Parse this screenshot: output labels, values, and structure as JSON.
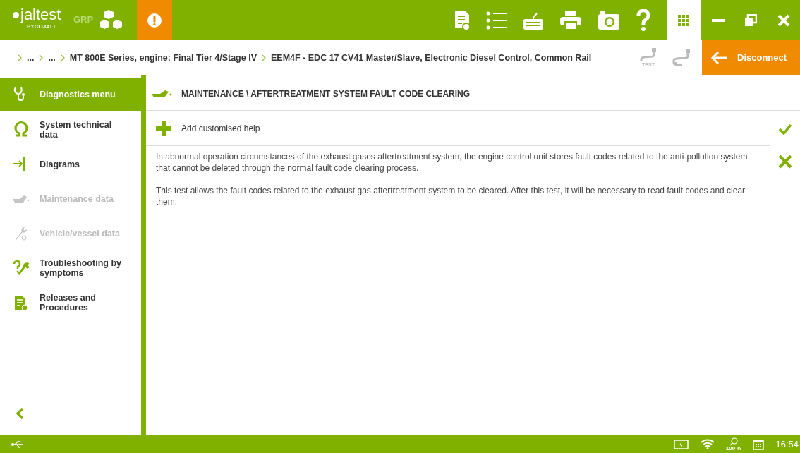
{
  "header": {
    "logo": "jaltest",
    "byline": "BY**COJALI**",
    "product": "GRP",
    "alert_active": true
  },
  "breadcrumb": {
    "items": [
      "...",
      "...",
      "MT 800E Series, engine: Final Tier 4/Stage IV",
      "EEM4F - EDC 17 CV41 Master/Slave, Electronic Diesel Control, Common Rail"
    ],
    "test_label": "TEST",
    "disconnect": "Disconnect"
  },
  "sidebar": {
    "items": [
      {
        "label": "Diagnostics menu",
        "selected": true,
        "disabled": false
      },
      {
        "label": "System technical data",
        "selected": false,
        "disabled": false
      },
      {
        "label": "Diagrams",
        "selected": false,
        "disabled": false
      },
      {
        "label": "Maintenance data",
        "selected": false,
        "disabled": true
      },
      {
        "label": "Vehicle/vessel data",
        "selected": false,
        "disabled": true
      },
      {
        "label": "Troubleshooting by symptoms",
        "selected": false,
        "disabled": false
      },
      {
        "label": "Releases and Procedures",
        "selected": false,
        "disabled": false
      }
    ]
  },
  "page": {
    "title": "MAINTENANCE \\ AFTERTREATMENT SYSTEM FAULT CODE CLEARING",
    "add_help": "Add customised help",
    "paragraphs": [
      "In abnormal operation circumstances of the exhaust gases aftertreatment system, the engine control unit stores fault codes related to the anti-pollution system that cannot be deleted through the normal fault code clearing process.",
      "This test allows the fault codes related to the exhaust gas aftertreatment system to be cleared. After this test, it will be necessary to read fault codes and clear them."
    ]
  },
  "status_bar": {
    "zoom": "100 %",
    "time": "16:54"
  }
}
